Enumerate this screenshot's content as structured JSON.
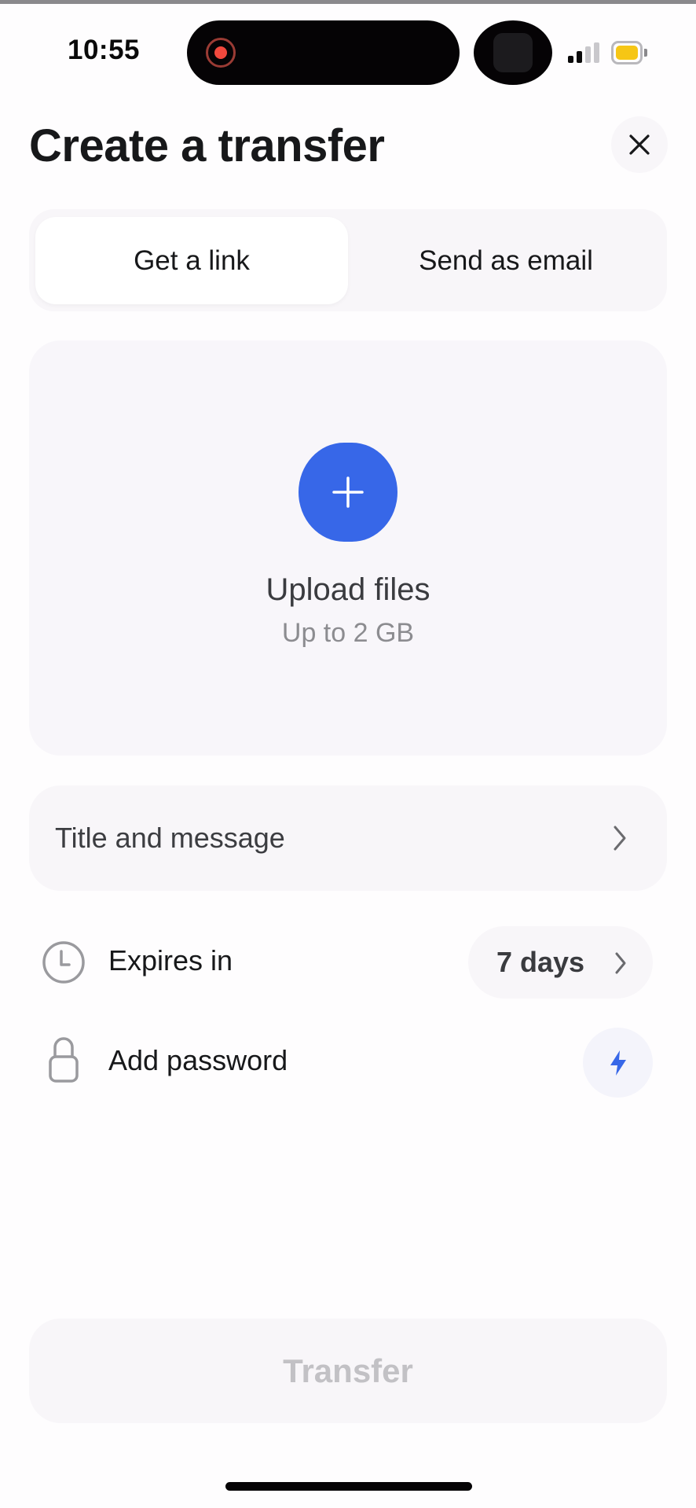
{
  "status_bar": {
    "time": "10:55",
    "recording_indicator": "screen-recording",
    "battery_color": "#f6c615"
  },
  "header": {
    "title": "Create a transfer",
    "close_icon": "close-icon"
  },
  "mode_tabs": {
    "tabs": [
      {
        "label": "Get a link",
        "selected": true
      },
      {
        "label": "Send as email",
        "selected": false
      }
    ]
  },
  "upload": {
    "icon": "plus-icon",
    "title": "Upload files",
    "subtitle": "Up to 2 GB",
    "accent_color": "#3767e8"
  },
  "title_message": {
    "label": "Title and message",
    "icon": "chevron-right-icon"
  },
  "expires": {
    "icon": "clock-icon",
    "label": "Expires in",
    "value": "7 days"
  },
  "password": {
    "icon": "lock-icon",
    "label": "Add password",
    "action_icon": "bolt-icon"
  },
  "footer": {
    "transfer_label": "Transfer"
  }
}
